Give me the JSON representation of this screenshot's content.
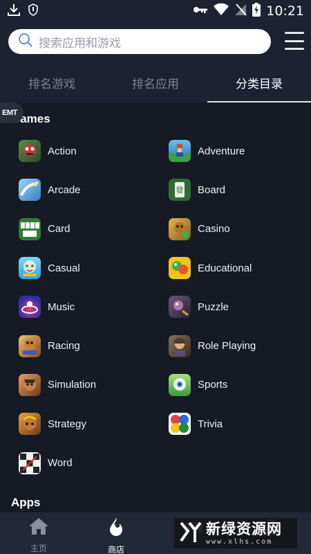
{
  "status_bar": {
    "time": "10:21"
  },
  "search": {
    "placeholder": "搜索应用和游戏"
  },
  "tabs": [
    {
      "label": "排名游戏"
    },
    {
      "label": "排名应用"
    },
    {
      "label": "分类目录",
      "active": true
    }
  ],
  "badge": {
    "text": "EMT"
  },
  "games_section": {
    "title": "Games",
    "categories": [
      {
        "label": "Action",
        "icon": "action-game-icon",
        "color": "#3c7a3a"
      },
      {
        "label": "Adventure",
        "icon": "adventure-game-icon",
        "color": "#4aa0d8"
      },
      {
        "label": "Arcade",
        "icon": "arcade-game-icon",
        "color": "#5aa8e0"
      },
      {
        "label": "Board",
        "icon": "board-game-icon",
        "color": "#2f6b35"
      },
      {
        "label": "Card",
        "icon": "card-game-icon",
        "color": "#2e7d32"
      },
      {
        "label": "Casino",
        "icon": "casino-game-icon",
        "color": "#c99b2e"
      },
      {
        "label": "Casual",
        "icon": "casual-game-icon",
        "color": "#52c6e8"
      },
      {
        "label": "Educational",
        "icon": "educational-game-icon",
        "color": "#f2c318"
      },
      {
        "label": "Music",
        "icon": "music-game-icon",
        "color": "#2a2fa8"
      },
      {
        "label": "Puzzle",
        "icon": "puzzle-game-icon",
        "color": "#4a3a5a"
      },
      {
        "label": "Racing",
        "icon": "racing-game-icon",
        "color": "#c0873a"
      },
      {
        "label": "Role Playing",
        "icon": "role-playing-game-icon",
        "color": "#6a5238"
      },
      {
        "label": "Simulation",
        "icon": "simulation-game-icon",
        "color": "#b5712e"
      },
      {
        "label": "Sports",
        "icon": "sports-game-icon",
        "color": "#57b84a"
      },
      {
        "label": "Strategy",
        "icon": "strategy-game-icon",
        "color": "#8a5a2a"
      },
      {
        "label": "Trivia",
        "icon": "trivia-game-icon",
        "color": "#e84040"
      },
      {
        "label": "Word",
        "icon": "word-game-icon",
        "color": "#e8e8e8"
      }
    ]
  },
  "apps_section": {
    "title": "Apps"
  },
  "bottom_nav": [
    {
      "label": "主页",
      "icon": "home-icon"
    },
    {
      "label": "商店",
      "icon": "store-flame-icon",
      "active": true
    },
    {
      "label": "",
      "icon": "gamepad-icon"
    },
    {
      "label": "",
      "icon": "profile-icon"
    }
  ],
  "watermark": {
    "main": "新绿资源网",
    "sub": "www.xlhs.com"
  }
}
